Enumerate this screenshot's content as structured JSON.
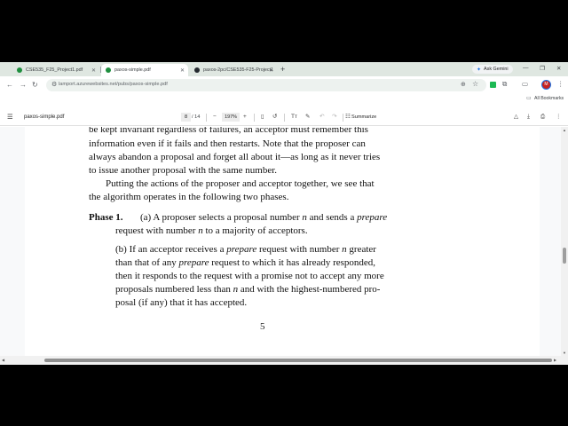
{
  "browser": {
    "tabs": [
      {
        "label": "CSE535_F25_Project1.pdf",
        "active": false,
        "fav_color": "#1e8e3e"
      },
      {
        "label": "paxos-simple.pdf",
        "active": true,
        "fav_color": "#1e8e3e"
      },
      {
        "label": "paxos-2pc/CSE535-F25-Project1",
        "active": false,
        "fav_color": "#24292f"
      }
    ],
    "ask_gemini": "Ask Gemini",
    "url": "lamport.azurewebsites.net/pubs/paxos-simple.pdf",
    "bookmarks_label": "All Bookmarks",
    "profile_initial": "M"
  },
  "viewer": {
    "file_title": "paxos-simple.pdf",
    "current_page": "8",
    "total_pages": "/ 14",
    "zoom": "197%",
    "summarize_label": "Summarize"
  },
  "document": {
    "lines": [
      {
        "html": "be kept invariant regardless of failures, an acceptor must remember this"
      },
      {
        "html": "information even if it fails and then restarts.  Note that the proposer can"
      },
      {
        "html": "always abandon a proposal and forget all about it—as long as it never tries"
      },
      {
        "html": "to issue another proposal with the same number."
      },
      {
        "html": "Putting the actions of the proposer and acceptor together, we see that"
      },
      {
        "html": "the algorithm operates in the following two phases."
      },
      {
        "html": "(a) A proposer selects a proposal number <i>n</i> and sends a <i>prepare</i>"
      },
      {
        "html": "request with number <i>n</i> to a majority of acceptors."
      },
      {
        "html": "(b) If an acceptor receives a <i>prepare</i> request with number <i>n</i> greater"
      },
      {
        "html": "than that of any <i>prepare</i> request to which it has already responded,"
      },
      {
        "html": "then it responds to the request with a promise not to accept any more"
      },
      {
        "html": "proposals numbered less than <i>n</i> and with the highest-numbered pro-"
      },
      {
        "html": "posal (if any) that it has accepted."
      }
    ],
    "phase_heading": "Phase 1.",
    "page_number": "5"
  }
}
